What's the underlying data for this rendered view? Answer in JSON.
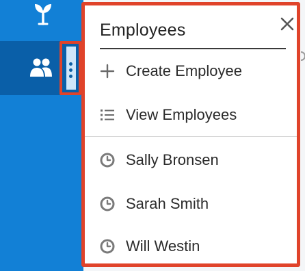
{
  "popover": {
    "title": "Employees",
    "actions": [
      {
        "label": "Create Employee",
        "icon": "plus-icon"
      },
      {
        "label": "View Employees",
        "icon": "list-icon"
      }
    ],
    "recent": [
      {
        "label": "Sally Bronsen",
        "icon": "clock-icon"
      },
      {
        "label": "Sarah Smith",
        "icon": "clock-icon"
      },
      {
        "label": "Will Westin",
        "icon": "clock-icon"
      }
    ]
  },
  "colors": {
    "sidebar": "#1280d6",
    "sidebar_active": "#0a5fa8",
    "highlight": "#e0432a",
    "icon_gray": "#7a7a7a"
  },
  "sidebar": {
    "icons": [
      "sprout-icon",
      "people-icon",
      "vertical-dots-icon"
    ]
  }
}
